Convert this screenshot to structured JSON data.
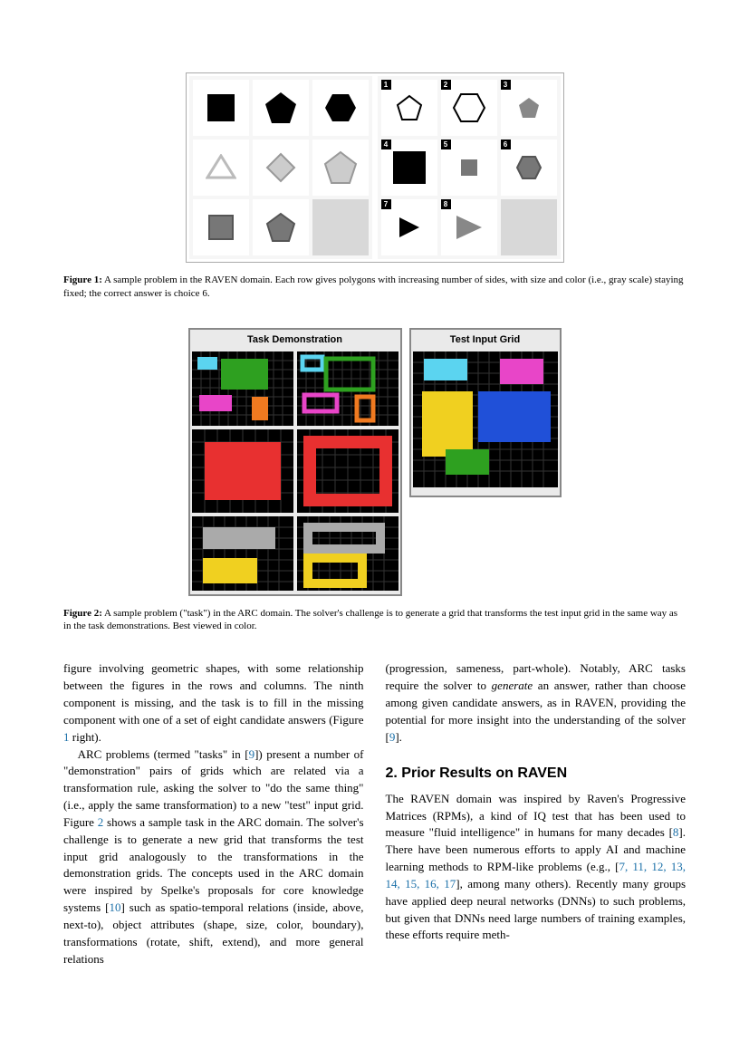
{
  "figure1": {
    "caption_label": "Figure 1:",
    "caption_text": "A sample problem in the RAVEN domain. Each row gives polygons with increasing number of sides, with size and color (i.e., gray scale) staying fixed; the correct answer is choice 6.",
    "answers_labels": [
      "1",
      "2",
      "3",
      "4",
      "5",
      "6",
      "7",
      "8"
    ]
  },
  "figure2": {
    "title_demo": "Task Demonstration",
    "title_test": "Test Input Grid",
    "caption_label": "Figure 2:",
    "caption_text": "A sample problem (\"task\") in the ARC domain. The solver's challenge is to generate a grid that transforms the test input grid in the same way as in the task demonstrations. Best viewed in color."
  },
  "body": {
    "p1": "figure involving geometric shapes, with some relationship between the figures in the rows and columns. The ninth component is missing, and the task is to fill in the missing component with one of a set of eight candidate answers (Figure ",
    "p1_ref": "1",
    "p1_tail": " right).",
    "p2a": "ARC problems (termed \"tasks\" in [",
    "p2_ref9": "9",
    "p2b": "]) present a number of \"demonstration\" pairs of grids which are related via a transformation rule, asking the solver to \"do the same thing\" (i.e., apply the same transformation) to a new \"test\" input grid. Figure ",
    "p2_fig2": "2",
    "p2c": " shows a sample task in the ARC domain. The solver's challenge is to generate a new grid that transforms the test input grid analogously to the transformations in the demonstration grids. The concepts used in the ARC domain were inspired by Spelke's proposals for core knowledge systems [",
    "p2_ref10": "10",
    "p2d": "] such as spatio-temporal relations (inside, above, next-to), object attributes (shape, size, color, boundary), transformations (rotate, shift, extend), and more general relations",
    "p3a": "(progression, sameness, part-whole). Notably, ARC tasks require the solver to ",
    "p3_em": "generate",
    "p3b": " an answer, rather than choose among given candidate answers, as in RAVEN, providing the potential for more insight into the understanding of the solver [",
    "p3_ref9": "9",
    "p3c": "].",
    "h2": "2.  Prior Results on RAVEN",
    "p4a": "The RAVEN domain was inspired by Raven's Progressive Matrices (RPMs), a kind of IQ test that has been used to measure \"fluid intelligence\" in humans for many decades [",
    "p4_ref8": "8",
    "p4b": "]. There have been numerous efforts to apply AI and machine learning methods to RPM-like problems (e.g., [",
    "p4_refs": "7, 11, 12, 13, 14, 15, 16, 17",
    "p4c": "], among many others). Recently many groups have applied deep neural networks (DNNs) to such problems, but given that DNNs need large numbers of training examples, these efforts require meth-"
  }
}
